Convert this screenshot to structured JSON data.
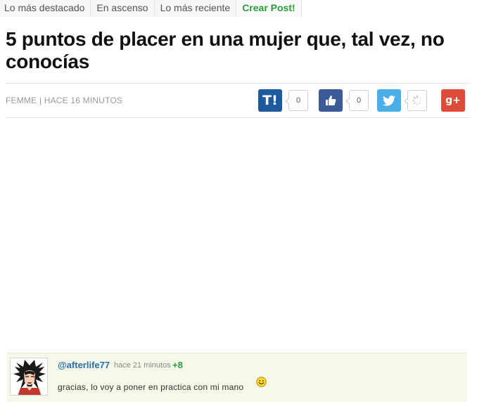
{
  "tabs": [
    {
      "label": "Lo más destacado"
    },
    {
      "label": "En ascenso"
    },
    {
      "label": "Lo más reciente"
    },
    {
      "label": "Crear Post!"
    }
  ],
  "post": {
    "title": "5 puntos de placer en una mujer que, tal vez, no conocías",
    "meta": "FEMME | HACE 16 MINUTOS"
  },
  "share": {
    "taringa": {
      "icon": "taringa-icon",
      "label": "T!",
      "count": "0",
      "color": "#1e5aa0"
    },
    "facebook": {
      "icon": "thumbs-up-icon",
      "count": "0",
      "color": "#3b5b98"
    },
    "twitter": {
      "icon": "twitter-bird-icon",
      "count": "loading",
      "color": "#4aaee8"
    },
    "gplus": {
      "icon": "google-plus-icon",
      "label": "g+",
      "color": "#dd4b39"
    }
  },
  "comment": {
    "user": "@afterlife77",
    "time": "hace 21 minutos",
    "score": "+8",
    "text": "gracias, lo voy a poner en practica con mi mano",
    "emoticon": "smiley-icon"
  }
}
